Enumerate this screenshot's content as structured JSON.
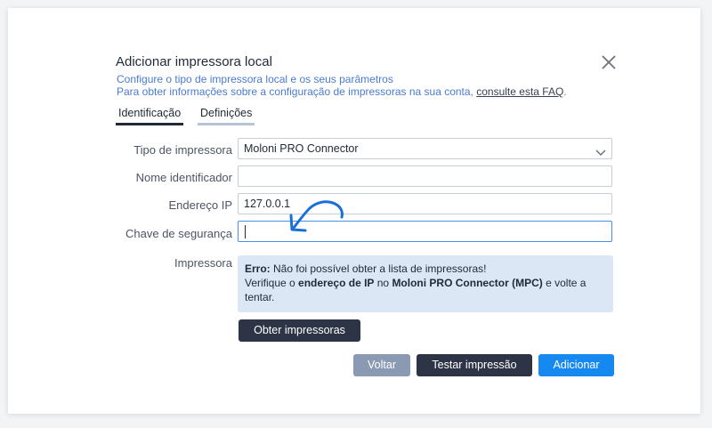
{
  "dialog": {
    "title": "Adicionar impressora local",
    "subtitle_line1": "Configure o tipo de impressora local e os seus parâmetros",
    "subtitle_line2_prefix": "Para obter informações sobre a configuração de impressoras na sua conta, ",
    "faq_link": "consulte esta FAQ",
    "subtitle_line2_suffix": "."
  },
  "tabs": {
    "identification": "Identificação",
    "definitions": "Definições"
  },
  "form": {
    "printer_type_label": "Tipo de impressora",
    "printer_type_value": "Moloni PRO Connector",
    "name_label": "Nome identificador",
    "name_value": "",
    "ip_label": "Endereço IP",
    "ip_value": "127.0.0.1",
    "security_key_label": "Chave de segurança",
    "security_key_value": "",
    "printer_label": "Impressora"
  },
  "error": {
    "prefix": "Erro:",
    "line1": " Não foi possível obter a lista de impressoras!",
    "line2_a": "Verifique o ",
    "line2_bold1": "endereço de IP",
    "line2_b": " no ",
    "line2_bold2": "Moloni PRO Connector (MPC)",
    "line2_c": " e volte a",
    "line3": "tentar."
  },
  "buttons": {
    "get_printers": "Obter impressoras",
    "back": "Voltar",
    "test_print": "Testar impressão",
    "add": "Adicionar"
  },
  "colors": {
    "accent_blue": "#1589f0",
    "dark_button": "#2c3445",
    "grey_button": "#8a9ab3",
    "error_bg": "#dbe7f5",
    "annotation_arrow": "#1a6fd8"
  },
  "icons": {
    "close": "close-icon",
    "chevron": "chevron-down-icon",
    "arrow": "curved-arrow-icon"
  }
}
